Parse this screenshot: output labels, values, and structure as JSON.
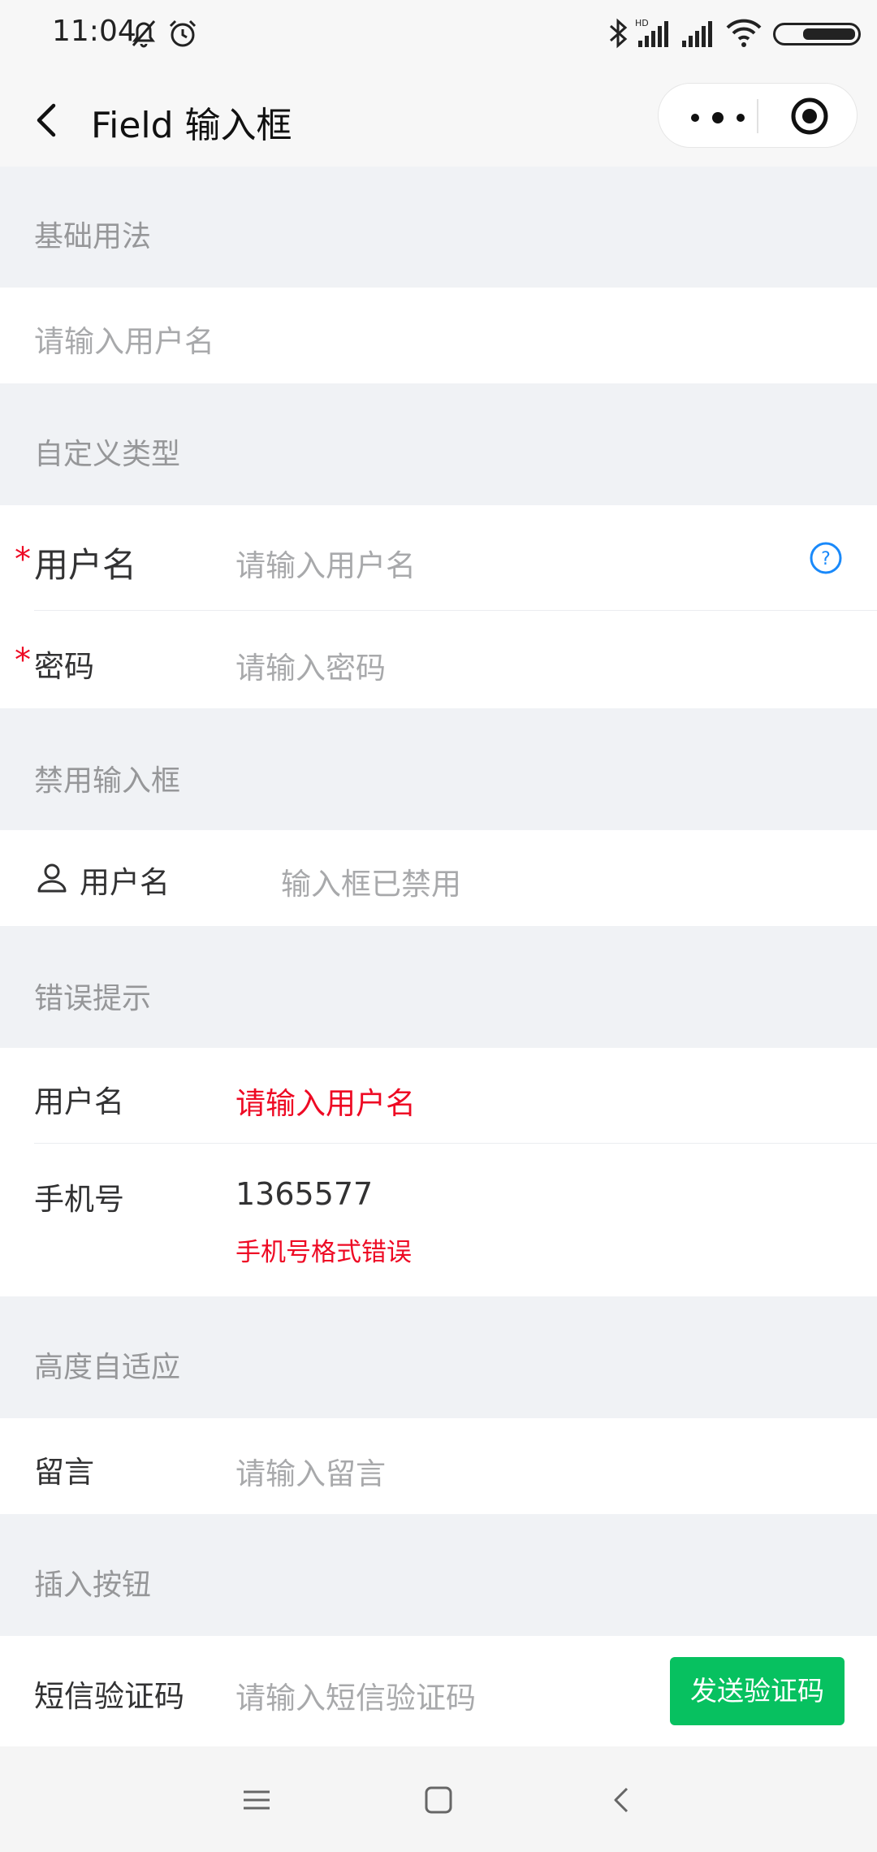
{
  "status_bar": {
    "time": "11:04"
  },
  "nav": {
    "title": "Field 输入框"
  },
  "sections": {
    "basic": {
      "title": "基础用法",
      "placeholder": "请输入用户名"
    },
    "custom": {
      "title": "自定义类型",
      "required_mark": "*",
      "username_label": "用户名",
      "username_placeholder": "请输入用户名",
      "password_label": "密码",
      "password_placeholder": "请输入密码"
    },
    "disabled": {
      "title": "禁用输入框",
      "label": "用户名",
      "value": "输入框已禁用"
    },
    "error": {
      "title": "错误提示",
      "username_label": "用户名",
      "username_placeholder": "请输入用户名",
      "phone_label": "手机号",
      "phone_value": "1365577",
      "phone_error": "手机号格式错误"
    },
    "autosize": {
      "title": "高度自适应",
      "label": "留言",
      "placeholder": "请输入留言"
    },
    "button": {
      "title": "插入按钮",
      "label": "短信验证码",
      "placeholder": "请输入短信验证码",
      "button_label": "发送验证码"
    }
  },
  "colors": {
    "error": "#ee0a24",
    "primary_button": "#07c160",
    "question_icon": "#1989fa"
  },
  "icons": [
    "bell-off-icon",
    "alarm-icon",
    "bluetooth-icon",
    "signal-icon",
    "wifi-icon",
    "battery-icon",
    "back-icon",
    "more-icon",
    "record-icon",
    "question-icon",
    "user-icon",
    "menu-icon",
    "home-icon",
    "nav-back-icon"
  ]
}
